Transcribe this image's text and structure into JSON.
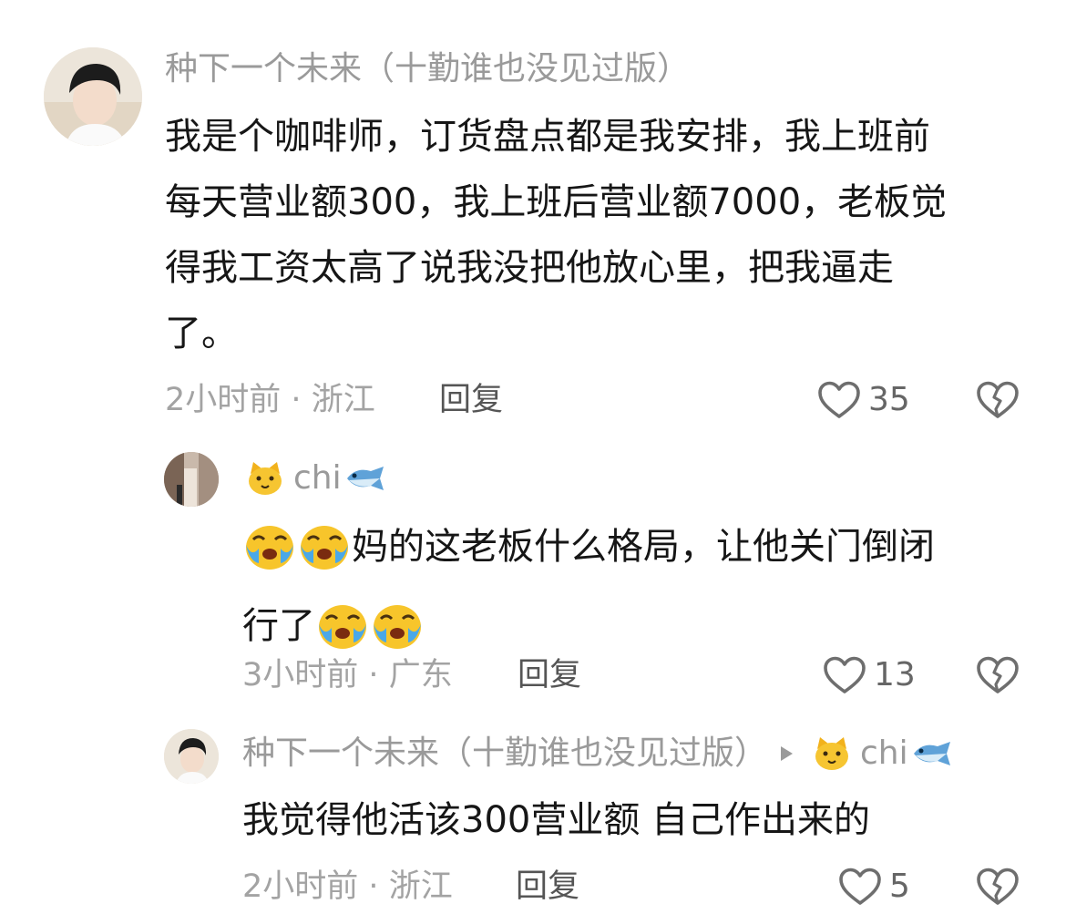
{
  "comments": [
    {
      "username": "种下一个未来（十勤谁也没见过版）",
      "text_lines": [
        "我是个咖啡师，订货盘点都是我安排，我上班前",
        "每天营业额300，我上班后营业额7000，老板觉",
        "得我工资太高了说我没把他放心里，把我逼走",
        "了。"
      ],
      "time": "2小时前",
      "location": "浙江",
      "reply_label": "回复",
      "likes": "35"
    },
    {
      "username": "chi",
      "text_line1": "妈的这老板什么格局，让他关门倒闭",
      "text_line2_prefix": "行了",
      "time": "3小时前",
      "location": "广东",
      "reply_label": "回复",
      "likes": "13"
    },
    {
      "username": "种下一个未来（十勤谁也没见过版）",
      "reply_to": "chi",
      "text": "我觉得他活该300营业额 自己作出来的",
      "time": "2小时前",
      "location": "浙江",
      "reply_label": "回复",
      "likes": "5"
    }
  ],
  "separator": "·",
  "colors": {
    "username": "#9a9a9a",
    "meta": "#a3a3a3",
    "text": "#161616",
    "icon": "#6e6e6e"
  }
}
